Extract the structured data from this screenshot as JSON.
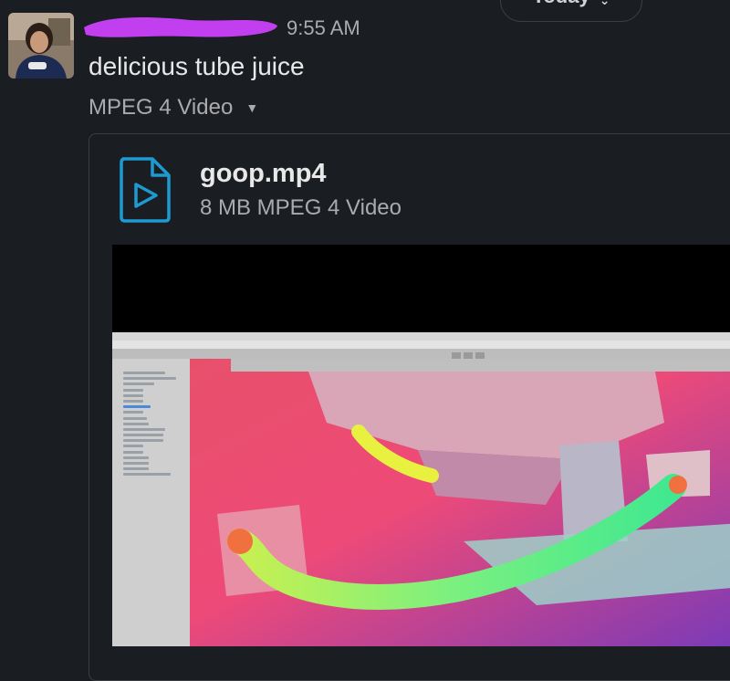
{
  "divider": {
    "label": "Today",
    "icon": "chevron-down-icon"
  },
  "message": {
    "time": "9:55 AM",
    "text": "delicious tube juice",
    "file_type_toggle": "MPEG 4 Video",
    "toggle_icon": "caret-down-icon"
  },
  "attachment": {
    "name": "goop.mp4",
    "meta": "8 MB MPEG 4 Video",
    "icon": "video-file-icon",
    "accent": "#1d9bd1"
  },
  "colors": {
    "background": "#1a1d21",
    "redaction": "#c23ff0"
  }
}
